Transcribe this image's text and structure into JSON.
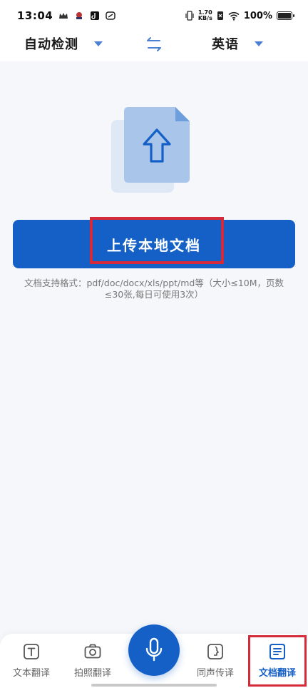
{
  "status_bar": {
    "time": "13:04",
    "net_speed_value": "1.70",
    "net_speed_unit": "KB/s",
    "battery": "100%"
  },
  "lang_bar": {
    "source_lang": "自动检测",
    "target_lang": "英语",
    "caret_icon": "caret-down-icon",
    "swap_icon": "swap-arrows-icon",
    "accent_color": "#4a7fd1"
  },
  "upload": {
    "illustration_icon": "document-upload-icon",
    "button_label": "上传本地文档",
    "hint_line1": "文档支持格式：pdf/doc/docx/xls/ppt/md等（大小≤10M，页数",
    "hint_line2": "≤30张,每日可使用3次）",
    "button_color": "#1560c6",
    "highlight_color": "#d42a3a"
  },
  "bottom_nav": {
    "items": [
      {
        "label": "文本翻译",
        "icon": "text-icon",
        "active": false
      },
      {
        "label": "拍照翻译",
        "icon": "camera-icon",
        "active": false
      },
      {
        "label": "同声传译",
        "icon": "face-profile-icon",
        "active": false
      },
      {
        "label": "文档翻译",
        "icon": "document-icon",
        "active": true
      }
    ],
    "mic_icon": "microphone-icon",
    "active_color": "#1560c6"
  }
}
